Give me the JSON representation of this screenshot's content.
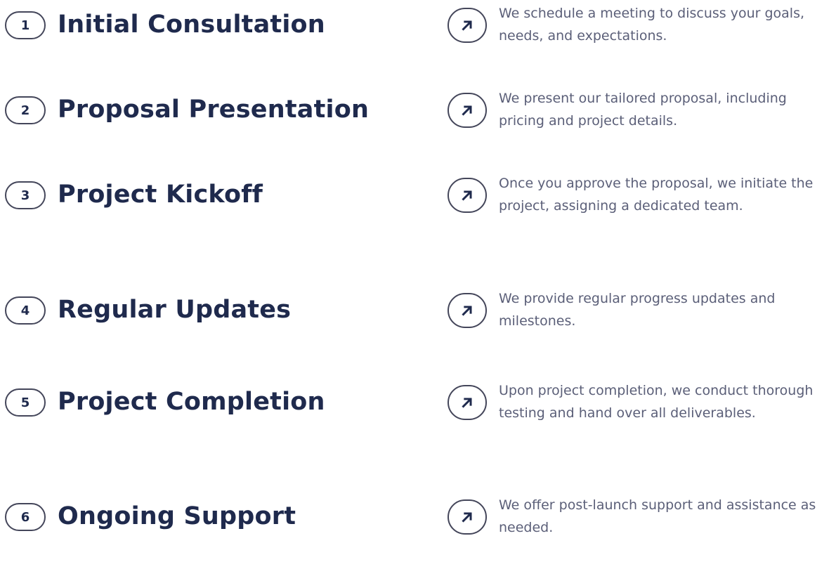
{
  "steps": [
    {
      "number": "1",
      "title": "Initial Consultation",
      "description": "We schedule a meeting to discuss your goals, needs, and expectations."
    },
    {
      "number": "2",
      "title": "Proposal Presentation",
      "description": "We present our tailored proposal, including pricing and project details."
    },
    {
      "number": "3",
      "title": "Project Kickoff",
      "description": "Once you approve the proposal, we initiate the project, assigning a dedicated team."
    },
    {
      "number": "4",
      "title": "Regular Updates",
      "description": "We provide regular progress updates and milestones."
    },
    {
      "number": "5",
      "title": "Project Completion",
      "description": "Upon project completion, we conduct thorough testing and hand over all deliverables."
    },
    {
      "number": "6",
      "title": "Ongoing Support",
      "description": "We offer post-launch support and assistance as needed."
    }
  ],
  "icons": {
    "arrow": "arrow-up-right-icon"
  },
  "colors": {
    "title": "#1f2a4d",
    "description": "#5b5f78",
    "border": "#44465a",
    "background": "#ffffff"
  }
}
